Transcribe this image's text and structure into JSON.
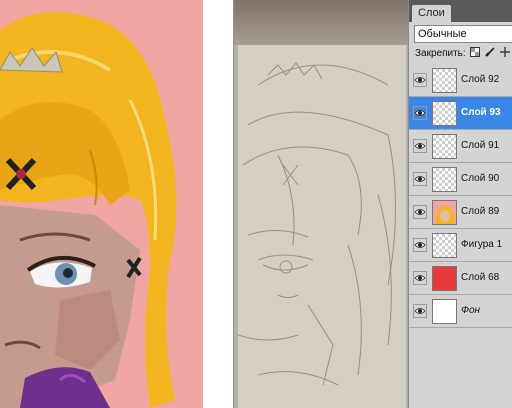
{
  "panel": {
    "tab_label": "Слои",
    "blend_mode": "Обычные",
    "lock_label": "Закрепить:",
    "lock_icons": [
      "lock-transparency-icon",
      "brush-icon",
      "move-icon"
    ]
  },
  "layers": [
    {
      "name": "Слой 92",
      "thumb": "transparent",
      "selected": false,
      "italic": false
    },
    {
      "name": "Слой 93",
      "thumb": "transparent",
      "selected": true,
      "italic": false
    },
    {
      "name": "Слой 91",
      "thumb": "transparent",
      "selected": false,
      "italic": false
    },
    {
      "name": "Слой 90",
      "thumb": "transparent",
      "selected": false,
      "italic": false
    },
    {
      "name": "Слой 89",
      "thumb": "art",
      "selected": false,
      "italic": false
    },
    {
      "name": "Фигура 1",
      "thumb": "transparent",
      "selected": false,
      "italic": false
    },
    {
      "name": "Слой 68",
      "thumb": "red",
      "selected": false,
      "italic": false
    },
    {
      "name": "Фон",
      "thumb": "white",
      "selected": false,
      "italic": true
    }
  ],
  "colors": {
    "selected_layer": "#3b87e6",
    "painting_background": "#f0a5a3",
    "hair": "#f2b51f"
  }
}
